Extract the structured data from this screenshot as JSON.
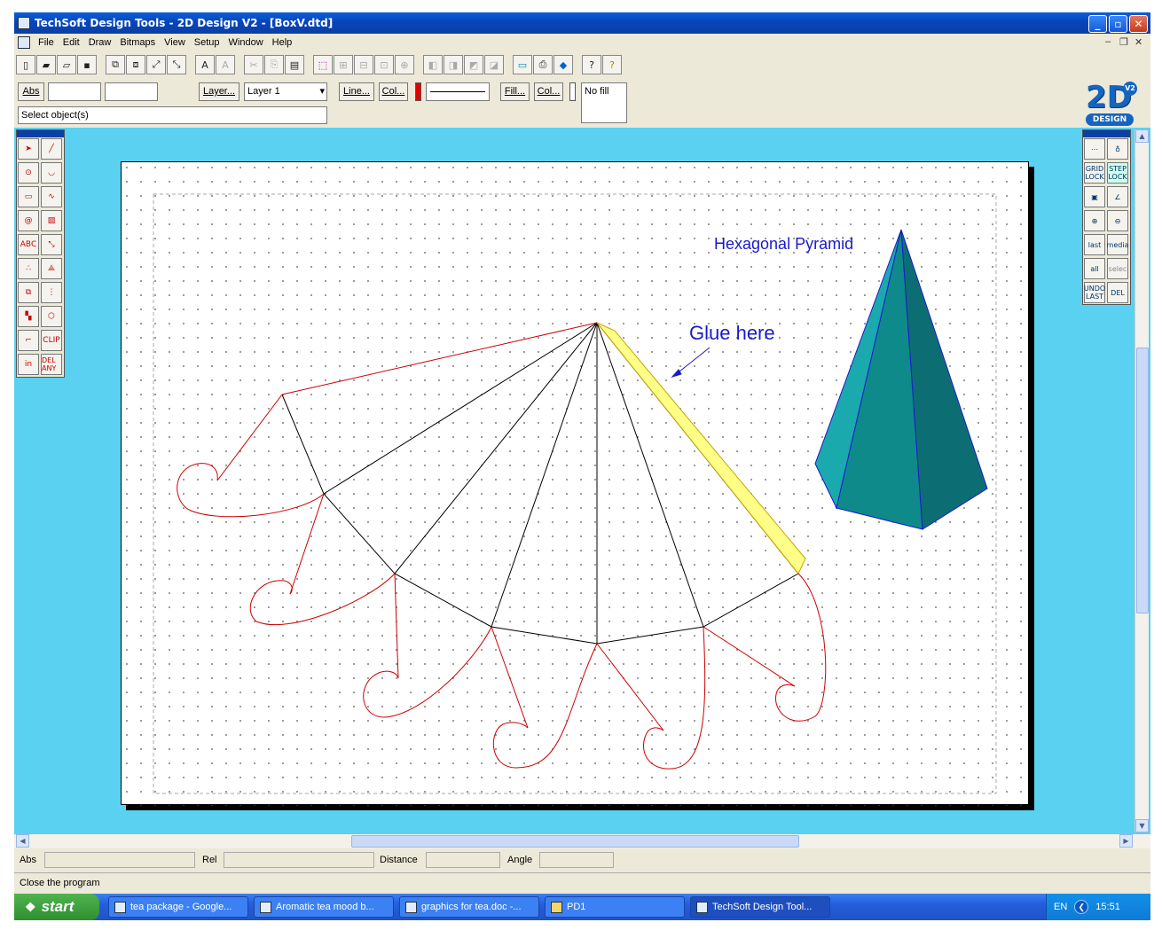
{
  "window": {
    "title": "TechSoft Design Tools - 2D Design V2 - [BoxV.dtd]"
  },
  "menu": [
    "File",
    "Edit",
    "Draw",
    "Bitmaps",
    "View",
    "Setup",
    "Window",
    "Help"
  ],
  "toolbar2": {
    "abs_label": "Abs",
    "layer_button": "Layer...",
    "layer_value": "Layer 1",
    "line_button": "Line...",
    "col_button": "Col...",
    "line_color": "#e00000",
    "fill_button": "Fill...",
    "fill_col_button": "Col...",
    "fill_value": "No fill",
    "prompt": "Select object(s)"
  },
  "logo": {
    "text": "2D",
    "badge": "V2",
    "sub": "DESIGN"
  },
  "left_tools": [
    {
      "icon": "arrow-icon"
    },
    {
      "icon": "line-icon"
    },
    {
      "icon": "circle-icon"
    },
    {
      "icon": "arc-icon"
    },
    {
      "icon": "rectangle-icon"
    },
    {
      "icon": "curve-icon"
    },
    {
      "icon": "spiral-icon"
    },
    {
      "icon": "hatch-icon"
    },
    {
      "label": "ABC",
      "icon": "text-icon"
    },
    {
      "icon": "dimension-icon"
    },
    {
      "icon": "points-icon"
    },
    {
      "icon": "transform-icon"
    },
    {
      "icon": "copy-icon"
    },
    {
      "icon": "array-icon"
    },
    {
      "icon": "fill-icon"
    },
    {
      "icon": "erase-icon"
    },
    {
      "icon": "trim-icon"
    },
    {
      "label": "CLIP",
      "icon": "clip-icon"
    },
    {
      "label": "in",
      "icon": "zoom-in-icon"
    },
    {
      "label": "DEL ANY",
      "icon": "delete-icon"
    }
  ],
  "right_tools": [
    {
      "icon": "grid-icon"
    },
    {
      "icon": "magnify-icon"
    },
    {
      "label": "GRID LOCK"
    },
    {
      "label": "STEP LOCK"
    },
    {
      "icon": "snap-box-icon"
    },
    {
      "icon": "angle-icon"
    },
    {
      "icon": "zoom-plus-icon"
    },
    {
      "icon": "zoom-minus-icon"
    },
    {
      "label": "last"
    },
    {
      "label": "media"
    },
    {
      "label": "all"
    },
    {
      "label": "selec"
    },
    {
      "label": "UNDO LAST"
    },
    {
      "label": "DEL"
    }
  ],
  "drawing": {
    "pyramid_label": "Hexagonal Pyramid",
    "glue_label": "Glue here",
    "colors": {
      "outline": "#cc0000",
      "fold": "#000000",
      "glue": "#ffff88",
      "text": "#1a1acc",
      "pyramid_light": "#1aa9ad",
      "pyramid_mid": "#0f8a8a",
      "pyramid_dark": "#0c6e72"
    }
  },
  "status": {
    "abs_label": "Abs",
    "rel_label": "Rel",
    "distance_label": "Distance",
    "angle_label": "Angle",
    "message": "Close the program"
  },
  "taskbar": {
    "start": "start",
    "tasks": [
      "tea package - Google...",
      "Aromatic tea mood b...",
      "graphics for tea.doc -...",
      "PD1",
      "TechSoft Design Tool..."
    ],
    "lang": "EN",
    "clock": "15:51"
  }
}
